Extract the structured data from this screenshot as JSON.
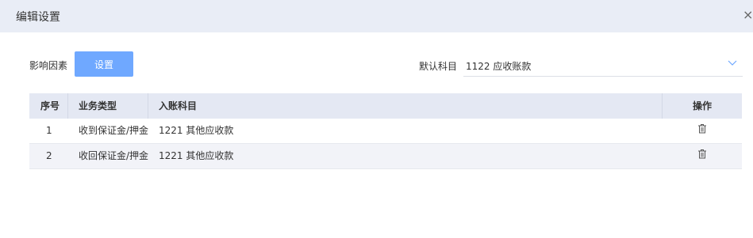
{
  "dialog": {
    "title": "编辑设置",
    "close_glyph": "×"
  },
  "form": {
    "factor_label": "影响因素",
    "set_button_label": "设置",
    "default_subject_label": "默认科目",
    "default_subject_value": "1122 应收账款"
  },
  "table": {
    "headers": {
      "index": "序号",
      "business_type": "业务类型",
      "entry_subject": "入账科目",
      "actions": "操作"
    },
    "rows": [
      {
        "index": "1",
        "business_type": "收到保证金/押金",
        "entry_subject": "1221 其他应收款"
      },
      {
        "index": "2",
        "business_type": "收回保证金/押金",
        "entry_subject": "1221 其他应收款"
      }
    ]
  },
  "icons": {
    "close": "close-icon",
    "dropdown": "chevron-down-icon",
    "delete": "trash-icon"
  },
  "colors": {
    "header_bg": "#e9edf6",
    "primary_button": "#6fa8ff",
    "table_header_bg": "#e4e8f3",
    "alt_row_bg": "#f2f3f8"
  }
}
